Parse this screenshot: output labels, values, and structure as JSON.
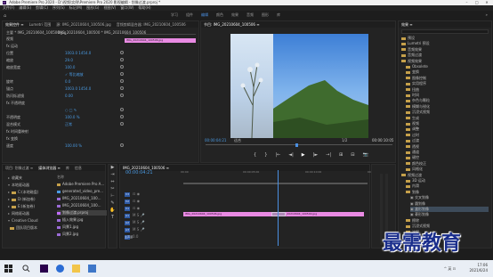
{
  "window": {
    "title": "Adobe Premiere Pro 2020 - D:\\视频\\实例\\Premiere Pro 2020 影视编辑 - 划像过渡.prproj *",
    "logo": "Pr"
  },
  "menu": [
    "文件(F)",
    "编辑(E)",
    "剪辑(C)",
    "序列(S)",
    "标记(M)",
    "图形(G)",
    "视图(V)",
    "窗口(W)",
    "帮助(H)"
  ],
  "workspaces": {
    "tabs": [
      "学习",
      "组件",
      "编辑",
      "颜色",
      "效果",
      "音频",
      "图形",
      "库"
    ],
    "active_index": 2,
    "more": "»"
  },
  "effect_controls": {
    "tabs": [
      "效果控件 ≡",
      "Lumetri 范围",
      "源: IMG_20210604_100506.jpg",
      "音频剪辑混合器: IMG_20210604_100506"
    ],
    "source_label": "主要 * IMG_20210604_100500.jpg",
    "sequence_label": "IMG_20210604_100500 * IMG_20210604_100506",
    "clip_bar_label": "IMG_20210604_100506.jpg",
    "rows": [
      {
        "label": "视频",
        "value": ""
      },
      {
        "label": "fx 运动",
        "value": ""
      },
      {
        "label": "位置",
        "value": "1003.0   1454.0"
      },
      {
        "label": "缩放",
        "value": "29.0"
      },
      {
        "label": "缩放宽度",
        "value": "100.0"
      },
      {
        "label": "",
        "value": "✓ 等比缩放"
      },
      {
        "label": "旋转",
        "value": "0.0"
      },
      {
        "label": "锚点",
        "value": "1003.0   1454.0"
      },
      {
        "label": "防闪烁滤镜",
        "value": "0.00"
      },
      {
        "label": "fx 不透明度",
        "value": ""
      },
      {
        "label": "",
        "value": "○ □ ✎"
      },
      {
        "label": "不透明度",
        "value": "100.0 %"
      },
      {
        "label": "混合模式",
        "value": "正常"
      },
      {
        "label": "fx 时间重映射",
        "value": ""
      },
      {
        "label": "fx 变换",
        "value": ""
      },
      {
        "label": "速度",
        "value": "100.00 %"
      }
    ]
  },
  "program_monitor": {
    "tab": "节目: IMG_20210604_100506 ≡",
    "timecode_left": "00:00:04:21",
    "fit": "适合",
    "fraction": "1/2",
    "timecode_right": "00:00:10:05",
    "controls": [
      "{",
      "}",
      "|←",
      "◄|",
      "▶",
      "|►",
      "→|",
      "⊞",
      "⊟",
      "📷"
    ]
  },
  "effects": {
    "tab": "效果 ≡",
    "items": [
      {
        "label": "预设",
        "indent": 0,
        "folder": true
      },
      {
        "label": "Lumetri 预设",
        "indent": 0,
        "folder": true
      },
      {
        "label": "音频效果",
        "indent": 0,
        "folder": true
      },
      {
        "label": "音频过渡",
        "indent": 0,
        "folder": true
      },
      {
        "label": "视频效果",
        "indent": 0,
        "folder": true
      },
      {
        "label": "Obsolete",
        "indent": 1,
        "folder": true
      },
      {
        "label": "变换",
        "indent": 1,
        "folder": true
      },
      {
        "label": "图像控制",
        "indent": 1,
        "folder": true
      },
      {
        "label": "实用程序",
        "indent": 1,
        "folder": true
      },
      {
        "label": "扭曲",
        "indent": 1,
        "folder": true
      },
      {
        "label": "时间",
        "indent": 1,
        "folder": true
      },
      {
        "label": "杂色与颗粒",
        "indent": 1,
        "folder": true
      },
      {
        "label": "模糊与锐化",
        "indent": 1,
        "folder": true
      },
      {
        "label": "沉浸式视频",
        "indent": 1,
        "folder": true
      },
      {
        "label": "生成",
        "indent": 1,
        "folder": true
      },
      {
        "label": "视频",
        "indent": 1,
        "folder": true
      },
      {
        "label": "调整",
        "indent": 1,
        "folder": true
      },
      {
        "label": "过时",
        "indent": 1,
        "folder": true
      },
      {
        "label": "过渡",
        "indent": 1,
        "folder": true
      },
      {
        "label": "透视",
        "indent": 1,
        "folder": true
      },
      {
        "label": "通道",
        "indent": 1,
        "folder": true
      },
      {
        "label": "键控",
        "indent": 1,
        "folder": true
      },
      {
        "label": "颜色校正",
        "indent": 1,
        "folder": true
      },
      {
        "label": "风格化",
        "indent": 1,
        "folder": true
      },
      {
        "label": "视频过渡",
        "indent": 0,
        "folder": true
      },
      {
        "label": "3D 运动",
        "indent": 1,
        "folder": true
      },
      {
        "label": "内滑",
        "indent": 1,
        "folder": true
      },
      {
        "label": "划像",
        "indent": 1,
        "folder": true
      },
      {
        "label": "交叉划像",
        "indent": 2,
        "folder": false
      },
      {
        "label": "圆划像",
        "indent": 2,
        "folder": false
      },
      {
        "label": "盒形划像",
        "indent": 2,
        "folder": false
      },
      {
        "label": "菱形划像",
        "indent": 2,
        "folder": false
      },
      {
        "label": "擦除",
        "indent": 1,
        "folder": true
      },
      {
        "label": "沉浸式视频",
        "indent": 1,
        "folder": true
      },
      {
        "label": "溶解",
        "indent": 1,
        "folder": true
      },
      {
        "label": "缩放",
        "indent": 1,
        "folder": true
      },
      {
        "label": "页面剥落",
        "indent": 1,
        "folder": true
      }
    ],
    "selected_index": 30
  },
  "project": {
    "tabs": [
      "项目: 划像过渡 ≡",
      "媒体浏览器 ≡",
      "库",
      "信息"
    ],
    "rows": [
      {
        "label": "收藏夹",
        "tri": "▸",
        "bin": false
      },
      {
        "label": "本地驱动器",
        "tri": "▾",
        "bin": false
      },
      {
        "label": "C:(本地磁盘)",
        "tri": "▸",
        "bin": true
      },
      {
        "label": "D:(新加卷)",
        "tri": "▸",
        "bin": true
      },
      {
        "label": "E:(新加卷)",
        "tri": "▸",
        "bin": true
      },
      {
        "label": "网络驱动器",
        "tri": "▸",
        "bin": false
      },
      {
        "label": "Creative Cloud",
        "tri": "▾",
        "bin": false
      },
      {
        "label": "团队项目版本",
        "tri": "",
        "bin": true
      }
    ]
  },
  "media_list": {
    "header": "名称",
    "rows": [
      {
        "label": "Adobe Premiere Pro A...",
        "chip": "#c5a04a"
      },
      {
        "label": "generated_video_pre...",
        "chip": "#4a9ae2"
      },
      {
        "label": "IMG_20210604_100...",
        "chip": "#9b6bd6"
      },
      {
        "label": "IMG_20210604_100...",
        "chip": "#9b6bd6"
      },
      {
        "label": "划像过渡.prproj",
        "chip": "#c06cff"
      },
      {
        "label": "插入效果.jpg",
        "chip": "#9b6bd6"
      },
      {
        "label": "风景1.jpg",
        "chip": "#9b6bd6"
      },
      {
        "label": "风景2.jpg",
        "chip": "#9b6bd6"
      }
    ],
    "selected_index": 4
  },
  "tools": [
    "▶",
    "⇥",
    "⇔",
    "✂",
    "⊢",
    "✎",
    "✋",
    "T"
  ],
  "timeline": {
    "tab": "IMG_20210604_100506 ≡",
    "timecode": "00:00:04:21",
    "ruler": [
      "00:00",
      "00:00:05:00",
      "00:00:10:00",
      "00:00:15:00"
    ],
    "tracks": [
      {
        "name": "V3",
        "icons": "⊡ ◉"
      },
      {
        "name": "V2",
        "icons": "⊡ ◉"
      },
      {
        "name": "V1",
        "icons": "⊡ ◉"
      },
      {
        "name": "A1",
        "icons": "M S 🎤"
      },
      {
        "name": "A2",
        "icons": "M S 🎤"
      },
      {
        "name": "A3",
        "icons": "M S 🎤"
      },
      {
        "name": "主声道",
        "icons": "0.0"
      }
    ],
    "clip1": "IMG_20210604_100506.jpg",
    "clip2": "IMG_20210604_100500.jpg"
  },
  "watermark": "最需教育",
  "taskbar": {
    "tray": "^ 英 ⊡",
    "time": "17:06",
    "date": "2021/6/24"
  },
  "colors": {
    "accent": "#4a90e2",
    "clip": "#e98ae3",
    "watermark": "#1a2e8c"
  }
}
